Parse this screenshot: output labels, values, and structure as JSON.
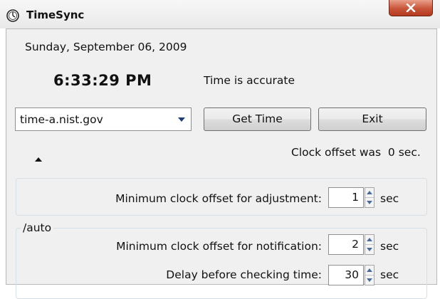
{
  "window": {
    "title": "TimeSync",
    "icon": "clock-icon",
    "close_icon": "close-icon",
    "close_color": "#c8543a"
  },
  "date": "Sunday, September 06, 2009",
  "time": "6:33:29 PM",
  "status": "Time is accurate",
  "server": {
    "selected": "time-a.nist.gov",
    "arrow_icon": "chevron-down-icon"
  },
  "buttons": {
    "get_time": "Get Time",
    "exit": "Exit"
  },
  "offset_text": "Clock offset was  0 sec.",
  "expand_icon": "triangle-up-icon",
  "settings": {
    "auto_label": "/auto",
    "min_adjust": {
      "label": "Minimum clock offset for adjustment:",
      "value": "1",
      "unit": "sec"
    },
    "min_notify": {
      "label": "Minimum clock offset for notification:",
      "value": "2",
      "unit": "sec"
    },
    "delay": {
      "label": "Delay before checking time:",
      "value": "30",
      "unit": "sec"
    }
  }
}
